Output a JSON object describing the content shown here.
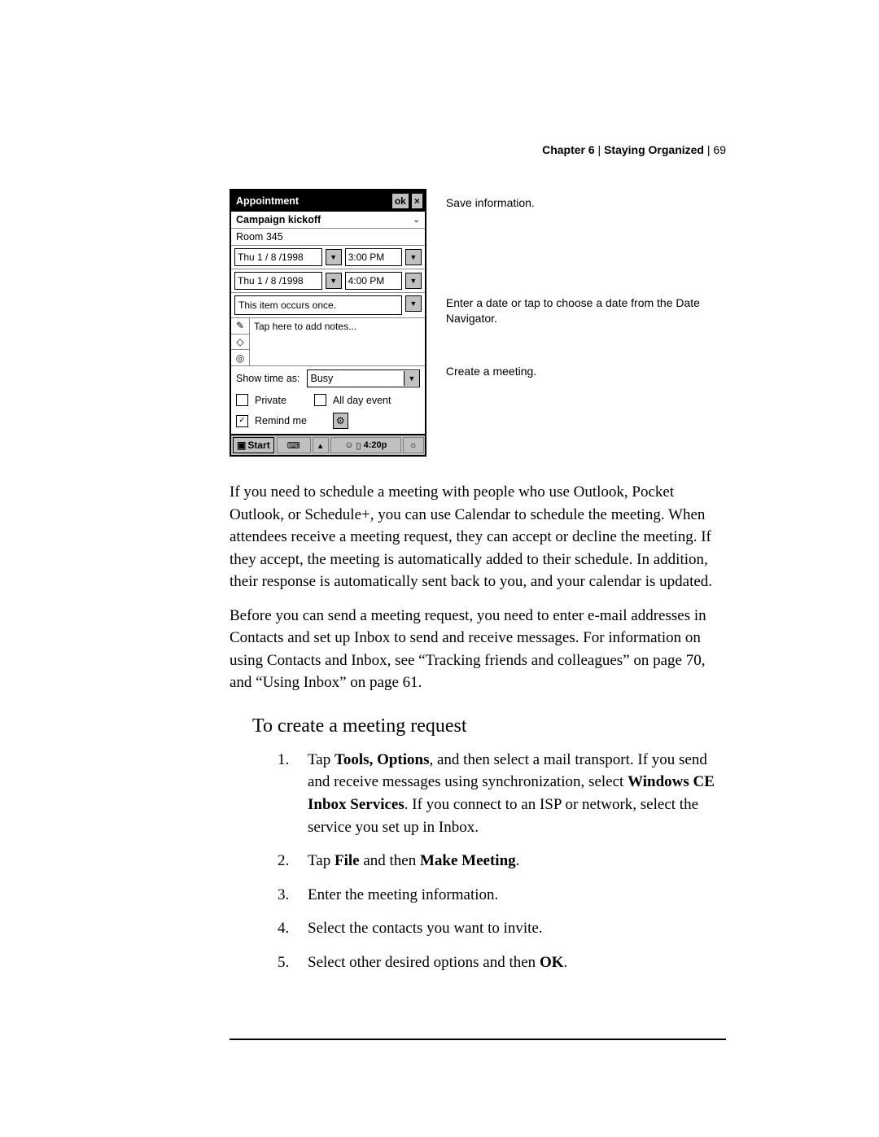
{
  "header": {
    "chapter": "Chapter 6",
    "sep": " | ",
    "title": "Staying Organized",
    "sep2": " | ",
    "page": "69"
  },
  "callouts": {
    "save": "Save information.",
    "date_nav": "Enter a date or tap to choose a date from the Date Navigator.",
    "meeting": "Create a meeting."
  },
  "appt": {
    "window_title": "Appointment",
    "ok": "ok",
    "close": "×",
    "subject": "Campaign kickoff",
    "location": "Room 345",
    "start_date": "Thu  1 / 8 /1998",
    "start_time": "3:00 PM",
    "end_date": "Thu  1 / 8 /1998",
    "end_time": "4:00 PM",
    "recurs": "This item occurs once.",
    "notes_placeholder": "Tap here to add notes...",
    "show_time_label": "Show time as:",
    "show_time_value": "Busy",
    "private_label": "Private",
    "allday_label": "All day event",
    "remind_label": "Remind me",
    "start_button": "Start",
    "clock": "4:20p"
  },
  "para1": "If you need to schedule a meeting with people who use Outlook, Pocket Outlook, or Schedule+, you can use Calendar to schedule the meeting. When attendees receive a meeting request, they can accept or decline the meeting. If they accept, the meeting is automatically added to their schedule. In addition, their response is automatically sent back to you, and your calendar is updated.",
  "para2": "Before you can send a meeting request, you need to enter e-mail addresses in Contacts and set up Inbox to send and receive messages. For information on using Contacts and Inbox, see “Tracking friends and colleagues” on page 70, and “Using Inbox” on page 61.",
  "heading": "To create a meeting request",
  "steps": {
    "s1_a": "Tap ",
    "s1_b": "Tools, Options",
    "s1_c": ", and then select a mail transport. If you send and receive messages using synchronization, select ",
    "s1_d": "Windows CE Inbox Services",
    "s1_e": ". If you connect to an ISP or network, select the service you set up in Inbox.",
    "s2_a": "Tap ",
    "s2_b": "File",
    "s2_c": " and then ",
    "s2_d": "Make Meeting",
    "s2_e": ".",
    "s3": "Enter the meeting information.",
    "s4": "Select the contacts you want to invite.",
    "s5_a": "Select other desired options and then ",
    "s5_b": "OK",
    "s5_c": "."
  }
}
